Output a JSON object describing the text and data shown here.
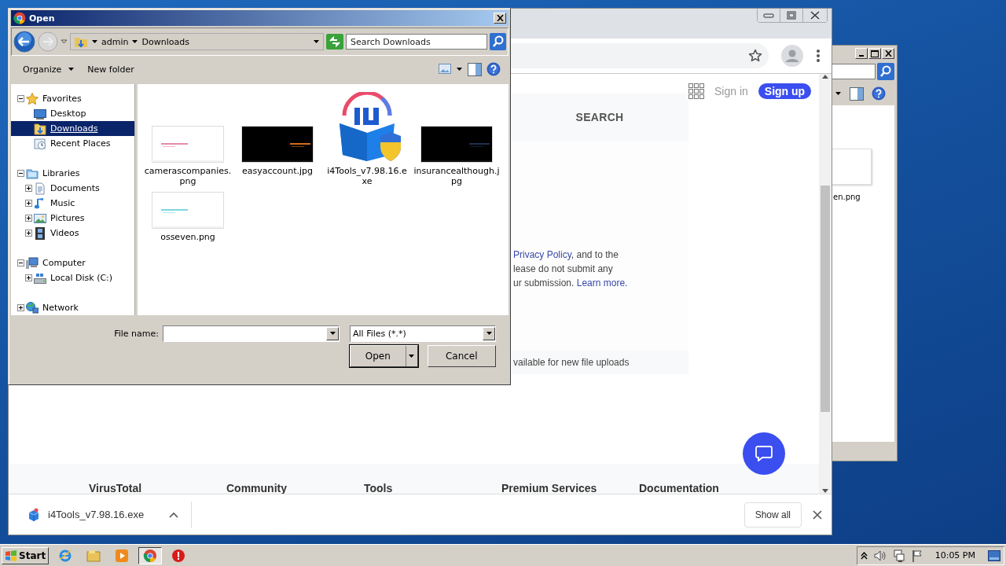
{
  "explorer_window": {
    "file_name": "en.png"
  },
  "browser": {
    "sign_in": "Sign in",
    "sign_up": "Sign up",
    "search_tab": "SEARCH",
    "notice_lines": [
      [
        {
          "text": "Privacy Policy",
          "link": true
        },
        {
          "text": ", and to the",
          "link": false
        }
      ],
      [
        {
          "text": "lease do not submit any",
          "link": false
        }
      ],
      [
        {
          "text": "ur submission. ",
          "link": false
        },
        {
          "text": "Learn more.",
          "link": true
        }
      ]
    ],
    "upload_note": "vailable for new file uploads",
    "footer_columns": [
      "VirusTotal",
      "Community",
      "Tools",
      "Premium Services",
      "Documentation"
    ],
    "download": {
      "file": "i4Tools_v7.98.16.exe",
      "show_all": "Show all"
    }
  },
  "dialog": {
    "title": "Open",
    "breadcrumb": [
      "admin",
      "Downloads"
    ],
    "search": {
      "placeholder": "Search Downloads"
    },
    "toolbar": [
      "Organize",
      "New folder"
    ],
    "nav_tree": [
      {
        "label": "Favorites",
        "kind": "favorites",
        "expanded": true,
        "selected": false,
        "children": [
          {
            "label": "Desktop",
            "kind": "desktop",
            "selected": false
          },
          {
            "label": "Downloads",
            "kind": "downloads",
            "selected": true
          },
          {
            "label": "Recent Places",
            "kind": "recent",
            "selected": false
          }
        ]
      },
      {
        "label": "Libraries",
        "kind": "libraries",
        "expanded": true,
        "selected": false,
        "children": [
          {
            "label": "Documents",
            "kind": "documents",
            "expanded": false,
            "selected": false
          },
          {
            "label": "Music",
            "kind": "music",
            "expanded": false,
            "selected": false
          },
          {
            "label": "Pictures",
            "kind": "pictures",
            "expanded": false,
            "selected": false
          },
          {
            "label": "Videos",
            "kind": "videos",
            "expanded": false,
            "selected": false
          }
        ]
      },
      {
        "label": "Computer",
        "kind": "computer",
        "expanded": true,
        "selected": false,
        "children": [
          {
            "label": "Local Disk (C:)",
            "kind": "disk",
            "expanded": false,
            "selected": false
          }
        ]
      },
      {
        "label": "Network",
        "kind": "network",
        "expanded": false,
        "selected": false
      }
    ],
    "files": [
      {
        "name_lines": [
          "camerascompanies.",
          "png"
        ],
        "kind": "picture"
      },
      {
        "name_lines": [
          "easyaccount.jpg"
        ],
        "kind": "picture"
      },
      {
        "name_lines": [
          "i4Tools_v7.98.16.e",
          "xe"
        ],
        "kind": "installer"
      },
      {
        "name_lines": [
          "insurancealthough.j",
          "pg"
        ],
        "kind": "picture"
      },
      {
        "name_lines": [
          "osseven.png"
        ],
        "kind": "picture"
      }
    ],
    "file_name": {
      "label": "File name:"
    },
    "file_type": "All Files (*.*)",
    "buttons": [
      "Open",
      "Cancel"
    ]
  },
  "taskbar": {
    "start": "Start",
    "apps": [
      {
        "kind": "ie",
        "active": false
      },
      {
        "kind": "explorer",
        "active": false
      },
      {
        "kind": "media",
        "active": false
      },
      {
        "kind": "chrome",
        "active": true
      },
      {
        "kind": "stop",
        "active": false
      }
    ],
    "clock": "10:05 PM"
  }
}
